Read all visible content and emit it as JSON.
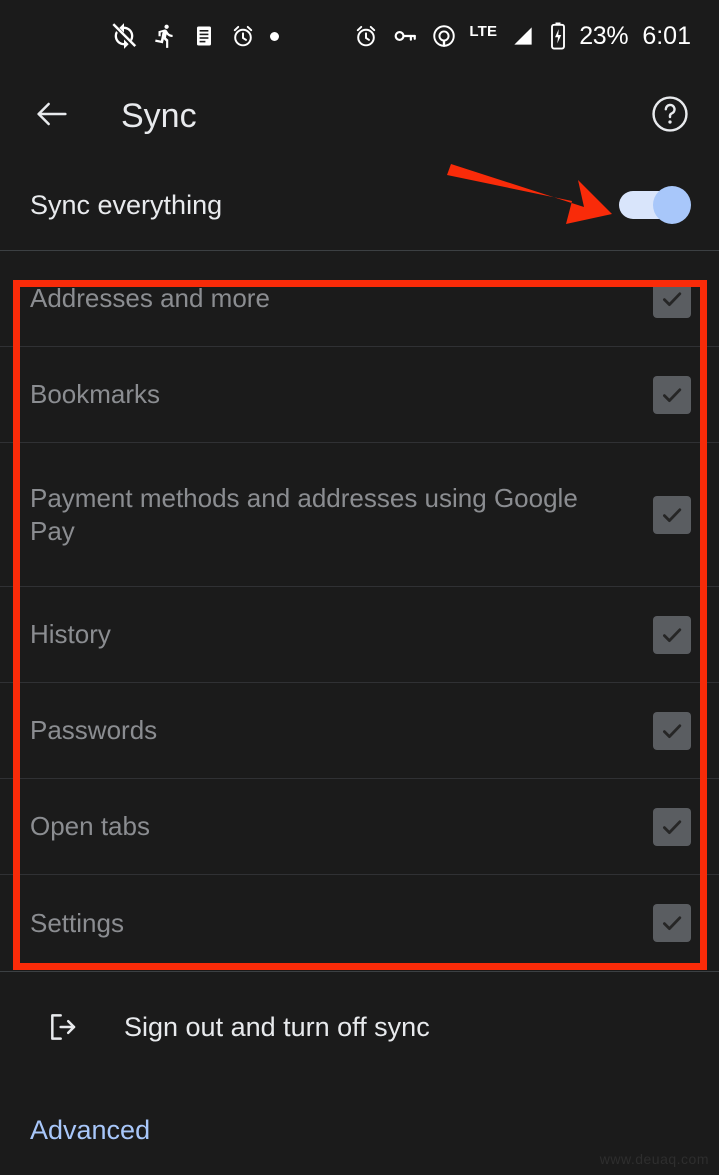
{
  "status_bar": {
    "left_icons": [
      {
        "name": "sync-disabled-icon",
        "label": "sync"
      },
      {
        "name": "running-person-icon",
        "label": "activity"
      },
      {
        "name": "document-list-icon",
        "label": "notes"
      },
      {
        "name": "alarm-clock-icon",
        "label": "alarm"
      },
      {
        "name": "notification-dot-icon",
        "label": "dot"
      }
    ],
    "right_icons": [
      {
        "name": "alarm-clock-icon",
        "label": "alarm"
      },
      {
        "name": "vpn-key-icon",
        "label": "vpn"
      },
      {
        "name": "hotspot-icon",
        "label": "hotspot"
      }
    ],
    "network_type": "LTE",
    "signal": "signal-bars-icon",
    "battery_icon": "battery-charging-icon",
    "battery_percent": "23%",
    "time": "6:01"
  },
  "app_bar": {
    "back_icon": "arrow-back-icon",
    "title": "Sync",
    "help_icon": "help-circle-icon"
  },
  "sync_everything": {
    "label": "Sync everything",
    "toggle_state": "on",
    "toggle_track_color": "#d9e5fb",
    "toggle_thumb_color": "#a8c7fa"
  },
  "data_types": [
    {
      "label": "Addresses and more",
      "checked": true,
      "enabled": false
    },
    {
      "label": "Bookmarks",
      "checked": true,
      "enabled": false
    },
    {
      "label": "Payment methods and addresses using Google Pay",
      "checked": true,
      "enabled": false
    },
    {
      "label": "History",
      "checked": true,
      "enabled": false
    },
    {
      "label": "Passwords",
      "checked": true,
      "enabled": false
    },
    {
      "label": "Open tabs",
      "checked": true,
      "enabled": false
    },
    {
      "label": "Settings",
      "checked": true,
      "enabled": false
    }
  ],
  "actions": {
    "sign_out_icon": "logout-icon",
    "sign_out_label": "Sign out and turn off sync",
    "advanced_label": "Advanced",
    "advanced_color": "#a8c7fa"
  },
  "annotations": {
    "box_color": "#f92b09",
    "arrow_color": "#f92b09",
    "box_target": "data-types-list",
    "arrow_target": "sync-everything-toggle"
  },
  "watermark": "www.deuaq.com"
}
